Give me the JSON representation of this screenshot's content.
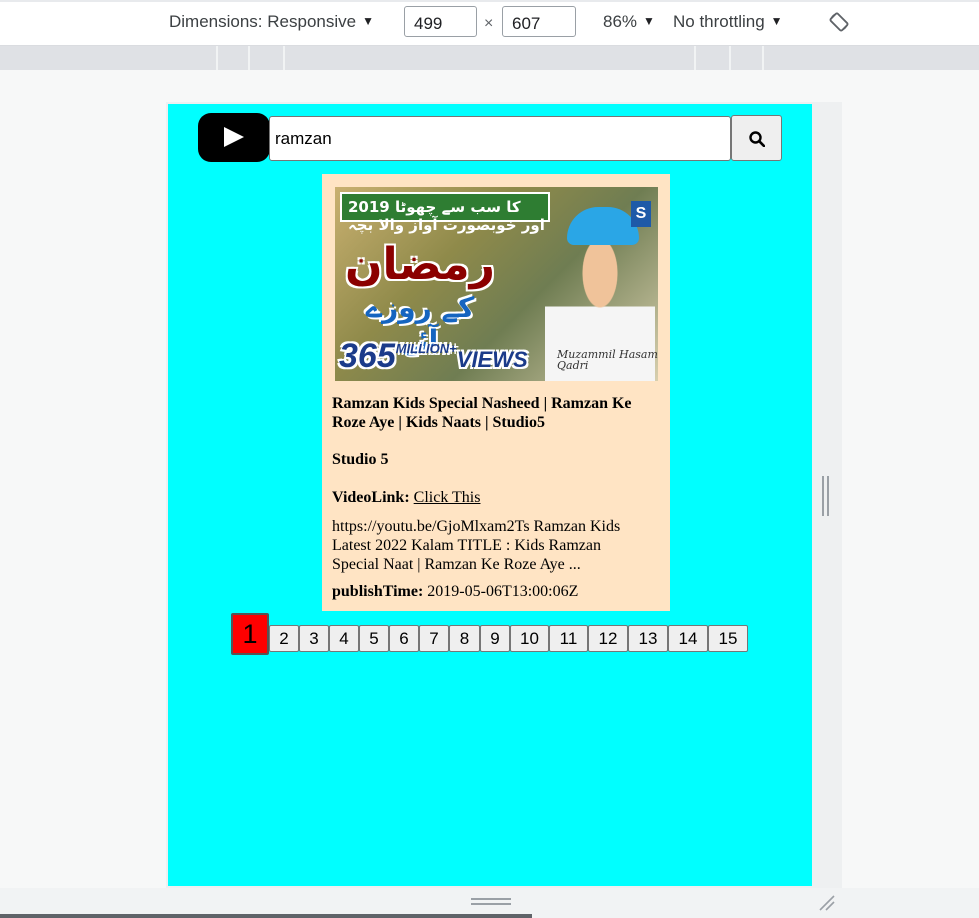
{
  "devtools": {
    "dimensions_label": "Dimensions: Responsive",
    "width": "499",
    "times": "×",
    "height": "607",
    "zoom": "86%",
    "throttling": "No throttling",
    "rotate_icon": "rotate-icon"
  },
  "app": {
    "search_value": "ramzan",
    "logo_icon": "youtube-play-icon",
    "search_icon": "magnifier-icon"
  },
  "video": {
    "thumb_banner": "2019 کا سب سے چھوٹا اور خوبصورت آواز والا بچہ",
    "thumb_title": "رمضان",
    "thumb_subtitle": "کے روزے آئے",
    "thumb_views_number": "365",
    "thumb_views_million": "MILLION+",
    "thumb_views_word": "VIEWS",
    "thumb_signature": "Muzammil Hasam Qadri",
    "thumb_logo": "S",
    "title": "Ramzan Kids Special Nasheed | Ramzan Ke Roze Aye | Kids Naats | Studio5",
    "channel": "Studio 5",
    "link_label": "VideoLink:",
    "link_text": "Click This",
    "description": "https://youtu.be/GjoMlxam2Ts Ramzan Kids Latest 2022 Kalam TITLE : Kids Ramzan Special Naat | Ramzan Ke Roze Aye ...",
    "publish_label": "publishTime:",
    "publish_time": "2019-05-06T13:00:06Z"
  },
  "pagination": {
    "active": "1",
    "pages": [
      "2",
      "3",
      "4",
      "5",
      "6",
      "7",
      "8",
      "9",
      "10",
      "11",
      "12",
      "13",
      "14",
      "15"
    ]
  },
  "colors": {
    "page_background": "#00ffff",
    "card_background": "#ffe4c4",
    "active_page": "#ff0000"
  }
}
